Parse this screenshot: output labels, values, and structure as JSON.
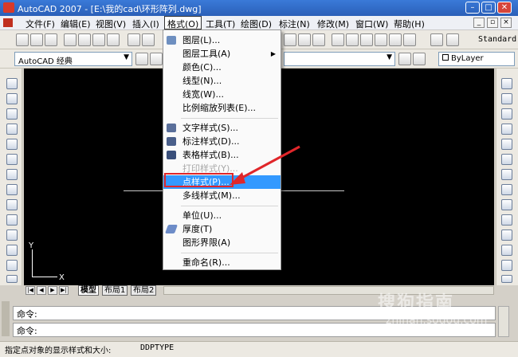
{
  "window": {
    "title": "AutoCAD 2007 - [E:\\我的cad\\环形阵列.dwg]"
  },
  "menu": {
    "items": [
      "文件(F)",
      "编辑(E)",
      "视图(V)",
      "插入(I)",
      "格式(O)",
      "工具(T)",
      "绘图(D)",
      "标注(N)",
      "修改(M)",
      "窗口(W)",
      "帮助(H)"
    ],
    "active": "格式(O)"
  },
  "toolbar": {
    "text_style": "Standard",
    "workspace": "AutoCAD 经典",
    "layer_combo": "ByLayer"
  },
  "format_menu": {
    "items": [
      {
        "label": "图层(L)...",
        "icon": "layers-icon"
      },
      {
        "label": "图层工具(A)",
        "submenu": true
      },
      {
        "label": "颜色(C)..."
      },
      {
        "label": "线型(N)..."
      },
      {
        "label": "线宽(W)..."
      },
      {
        "label": "比例缩放列表(E)..."
      },
      {
        "label": "文字样式(S)...",
        "icon": "text-style-icon"
      },
      {
        "label": "标注样式(D)...",
        "icon": "dim-style-icon"
      },
      {
        "label": "表格样式(B)...",
        "icon": "table-style-icon"
      },
      {
        "label": "打印样式(Y)...",
        "disabled": true
      },
      {
        "label": "点样式(P)...",
        "selected": true
      },
      {
        "label": "多线样式(M)..."
      },
      {
        "label": "单位(U)..."
      },
      {
        "label": "厚度(T)",
        "icon": "thickness-icon"
      },
      {
        "label": "图形界限(A)"
      },
      {
        "label": "重命名(R)..."
      }
    ],
    "submenu_arrow": "▶"
  },
  "drawing": {
    "ucs_x": "X",
    "ucs_y": "Y"
  },
  "layout_tabs": [
    "模型",
    "布局1",
    "布局2"
  ],
  "nav": [
    "|◀",
    "◀",
    "▶",
    "▶|"
  ],
  "command": {
    "line1": "命令:",
    "line2": "命令:"
  },
  "status": {
    "text": "指定点对象的显示样式和大小:",
    "command": "DDPTYPE"
  },
  "watermark": {
    "main": "搜狗指南",
    "sub": "zhinan.sogou.com"
  },
  "colors": {
    "selected": "#3399ff",
    "highlight_box": "#e0262a",
    "canvas": "#000000"
  }
}
